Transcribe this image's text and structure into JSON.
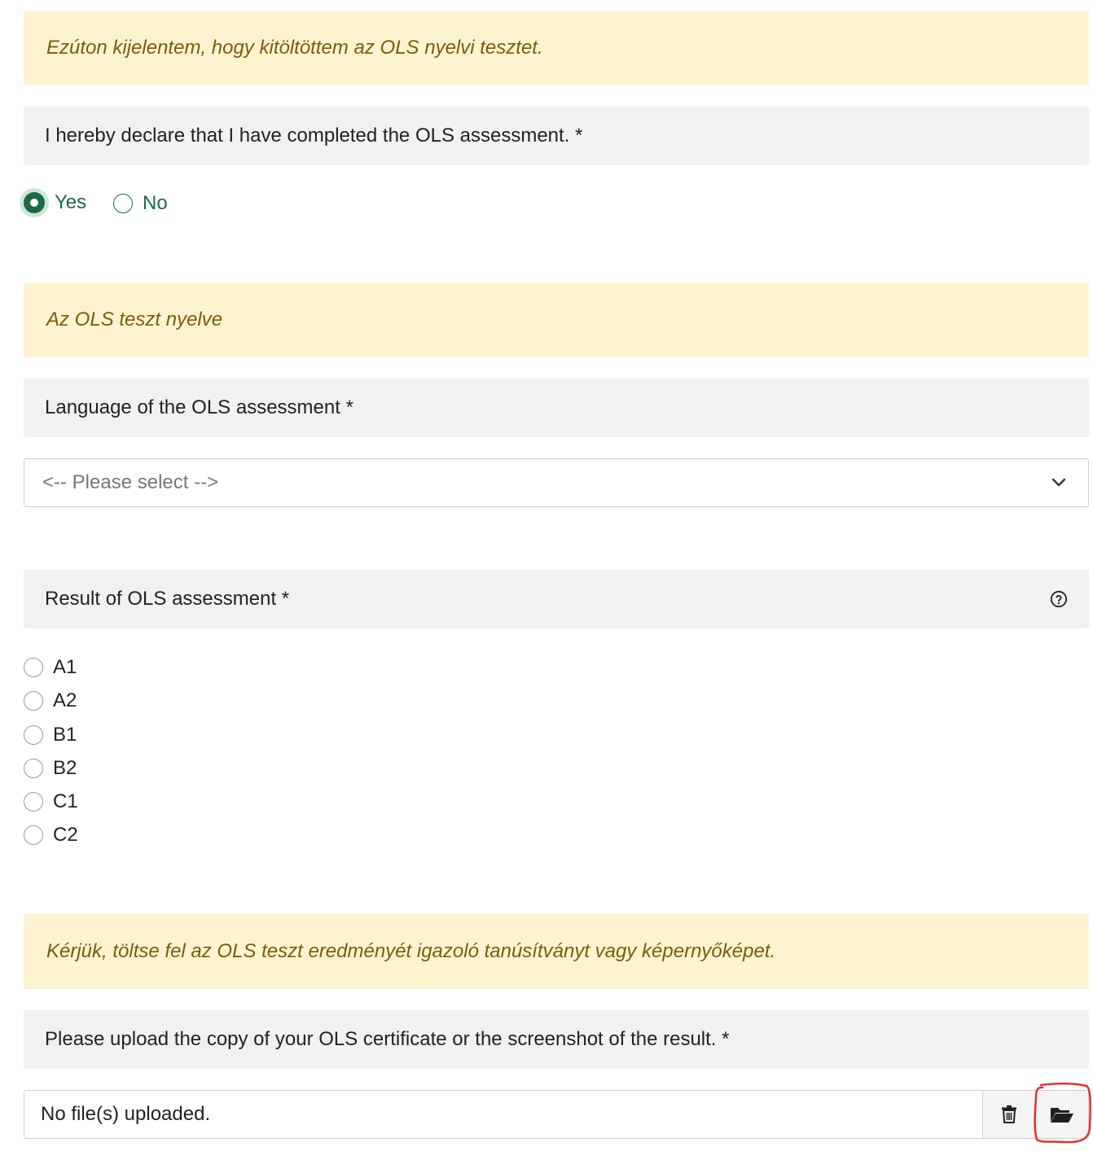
{
  "section1": {
    "note": "Ezúton kijelentem, hogy kitöltöttem az OLS nyelvi tesztet.",
    "label": "I hereby declare that I have completed the OLS assessment. *",
    "options": [
      {
        "label": "Yes",
        "selected": true
      },
      {
        "label": "No",
        "selected": false
      }
    ]
  },
  "section2": {
    "note": "Az OLS teszt nyelve",
    "label": "Language of the OLS assessment *",
    "select_placeholder": "<-- Please select -->"
  },
  "section3": {
    "label": "Result of OLS assessment *",
    "options": [
      "A1",
      "A2",
      "B1",
      "B2",
      "C1",
      "C2"
    ]
  },
  "section4": {
    "note": "Kérjük, töltse fel az OLS teszt eredményét igazoló tanúsítványt vagy képernyőképet.",
    "label": "Please upload the copy of your OLS certificate or the screenshot of the result. *",
    "file_status": "No file(s) uploaded."
  },
  "colors": {
    "accent": "#1b6b45",
    "note_bg": "#fdf3d0",
    "note_text": "#7a5c0c",
    "label_bg": "#f1f1f1",
    "annotation": "#e53030"
  },
  "icons": [
    "help-circle-icon",
    "chevron-down-icon",
    "trash-icon",
    "folder-open-icon"
  ]
}
